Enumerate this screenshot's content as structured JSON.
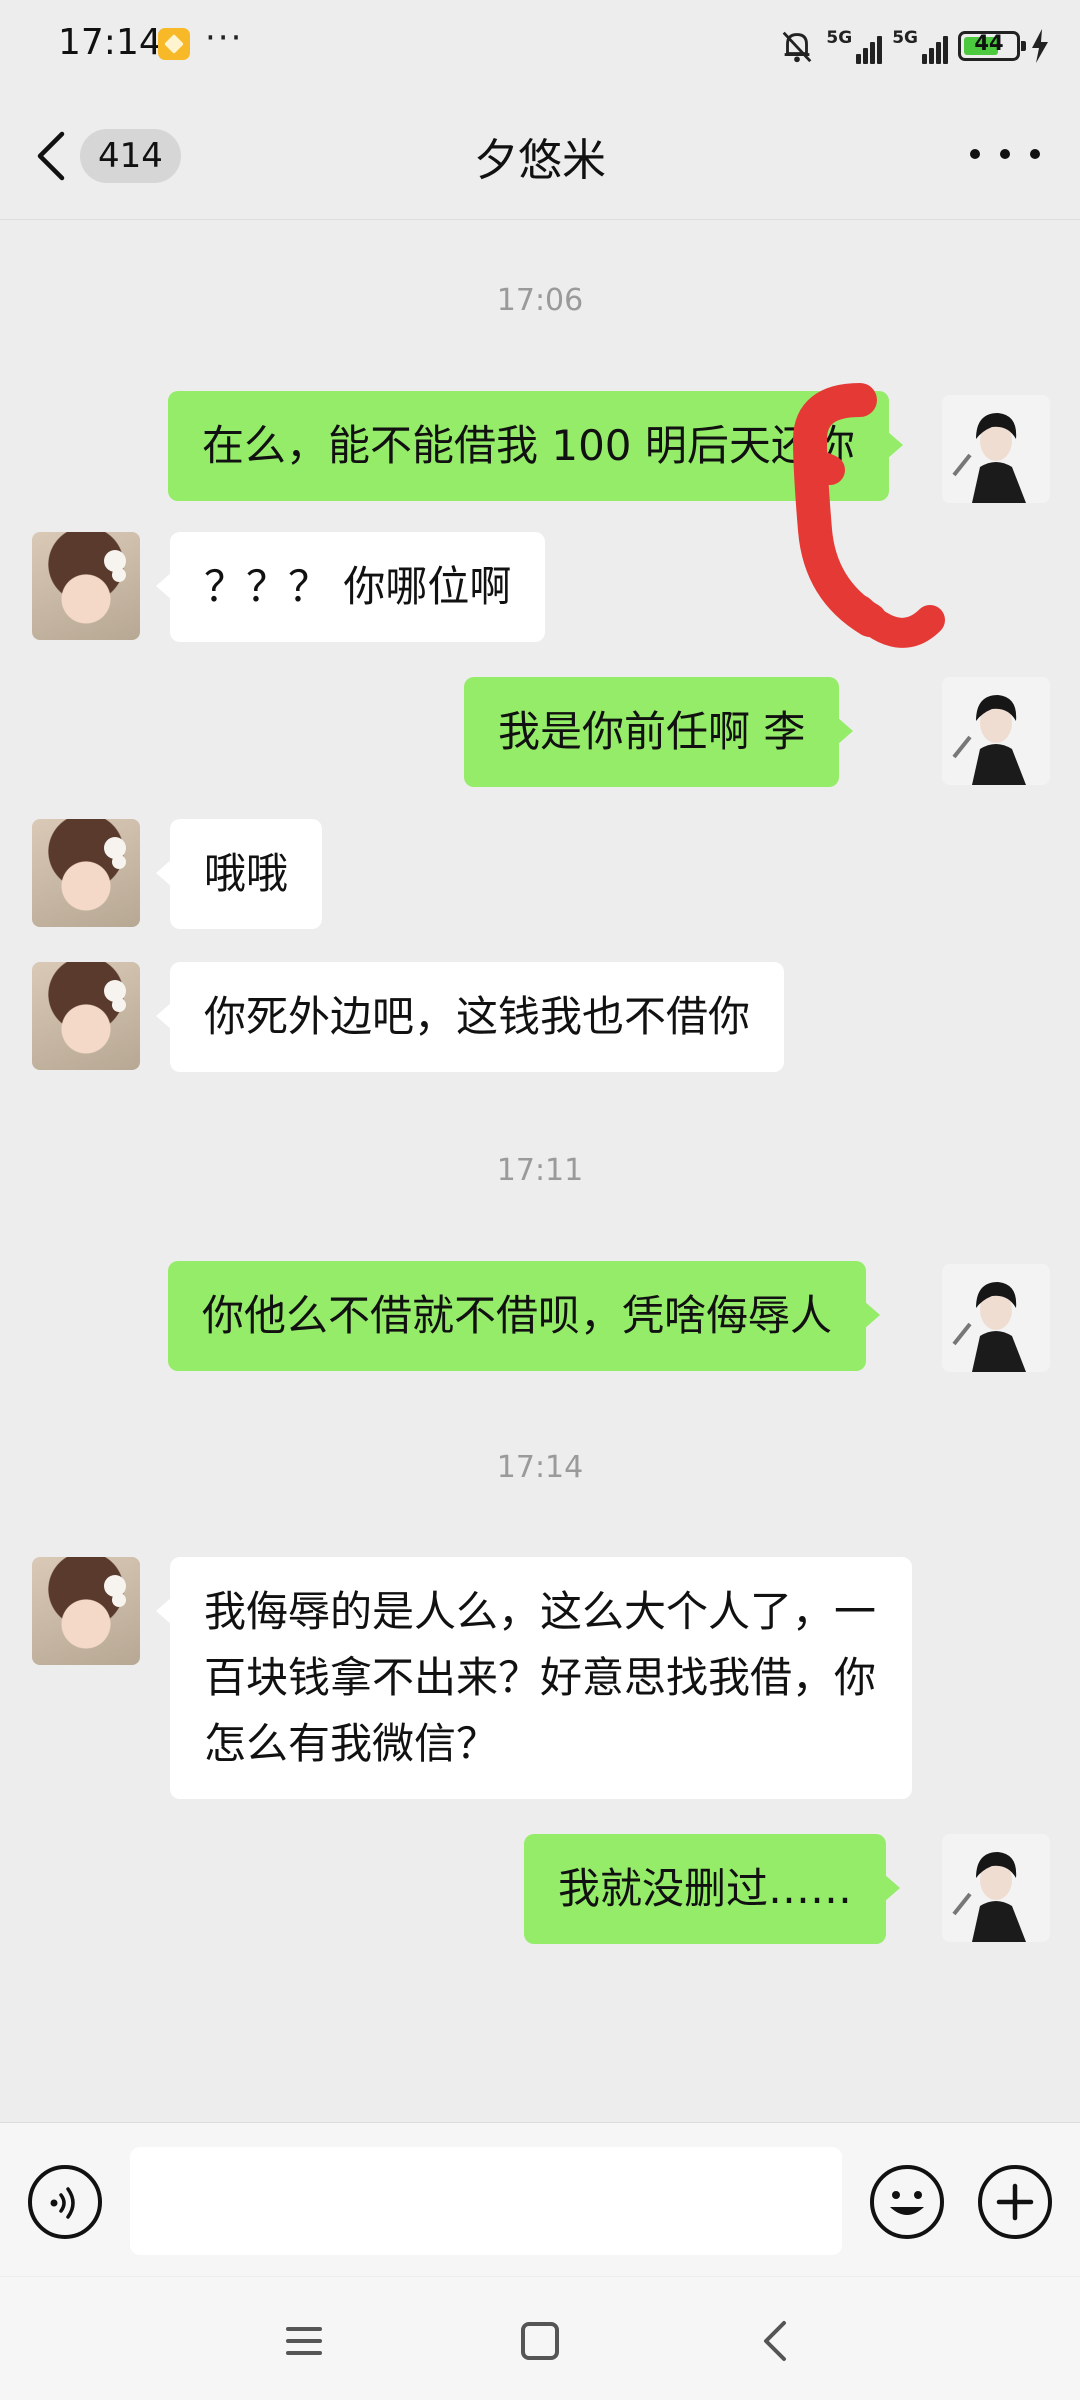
{
  "status_bar": {
    "time": "17:14",
    "more": "···",
    "network_1": "5G",
    "network_2": "5G",
    "battery": "44"
  },
  "header": {
    "unread_count": "414",
    "title": "夕悠米"
  },
  "messages": [
    {
      "type": "timestamp",
      "text": "17:06"
    },
    {
      "type": "message",
      "side": "out",
      "text": "在么，能不能借我 100 明后天还你"
    },
    {
      "type": "message",
      "side": "in",
      "text": "？？？ 你哪位啊"
    },
    {
      "type": "message",
      "side": "out",
      "text": "我是你前任啊 李"
    },
    {
      "type": "message",
      "side": "in",
      "text": "哦哦"
    },
    {
      "type": "message",
      "side": "in",
      "text": "你死外边吧，这钱我也不借你"
    },
    {
      "type": "timestamp",
      "text": "17:11"
    },
    {
      "type": "message",
      "side": "out",
      "text": "你他么不借就不借呗，凭啥侮辱人"
    },
    {
      "type": "timestamp",
      "text": "17:14"
    },
    {
      "type": "message",
      "side": "in",
      "text": "我侮辱的是人么，这么大个人了，一百块钱拿不出来？好意思找我借，你怎么有我微信？"
    },
    {
      "type": "message",
      "side": "out",
      "text": "我就没删过……"
    }
  ],
  "input": {
    "placeholder": ""
  },
  "icons": {
    "back": "chevron-left-icon",
    "more": "more-dots-icon",
    "voice": "voice-icon",
    "emoji": "emoji-icon",
    "plus": "plus-icon",
    "menu": "menu-icon",
    "home": "home-icon",
    "nav_back": "nav-back-icon"
  },
  "colors": {
    "background": "#ededed",
    "outgoing_bubble": "#95ec69",
    "incoming_bubble": "#ffffff",
    "timestamp_text": "#9a9a9a",
    "redaction": "#e53935"
  }
}
